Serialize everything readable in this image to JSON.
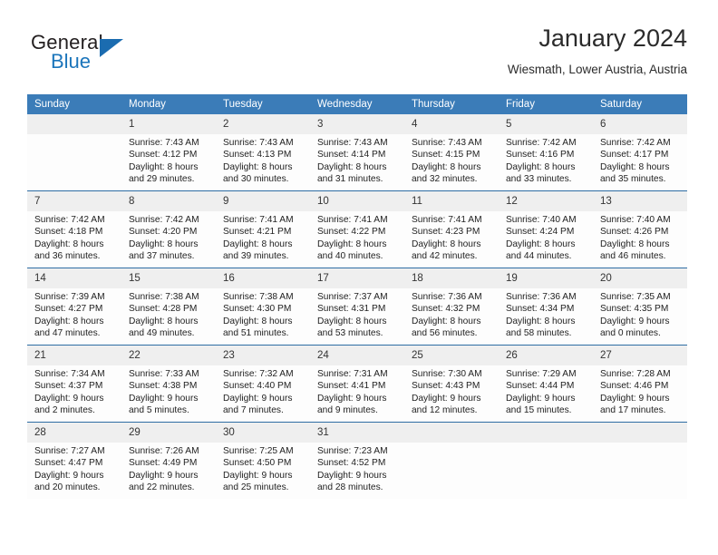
{
  "brand": {
    "name_top": "General",
    "name_bottom": "Blue",
    "accent_color": "#1b75bb",
    "triangle_color": "#1b6cb0"
  },
  "header": {
    "title": "January 2024",
    "location": "Wiesmath, Lower Austria, Austria"
  },
  "theme": {
    "header_row_bg": "#3b7cb8",
    "daynum_bg": "#efefef",
    "row_divider": "#2e6da4"
  },
  "weekday_headers": [
    "Sunday",
    "Monday",
    "Tuesday",
    "Wednesday",
    "Thursday",
    "Friday",
    "Saturday"
  ],
  "weeks": [
    [
      {
        "day": "",
        "empty": true,
        "sunrise": "",
        "sunset": "",
        "daylight_1": "",
        "daylight_2": ""
      },
      {
        "day": "1",
        "sunrise": "Sunrise: 7:43 AM",
        "sunset": "Sunset: 4:12 PM",
        "daylight_1": "Daylight: 8 hours",
        "daylight_2": "and 29 minutes."
      },
      {
        "day": "2",
        "sunrise": "Sunrise: 7:43 AM",
        "sunset": "Sunset: 4:13 PM",
        "daylight_1": "Daylight: 8 hours",
        "daylight_2": "and 30 minutes."
      },
      {
        "day": "3",
        "sunrise": "Sunrise: 7:43 AM",
        "sunset": "Sunset: 4:14 PM",
        "daylight_1": "Daylight: 8 hours",
        "daylight_2": "and 31 minutes."
      },
      {
        "day": "4",
        "sunrise": "Sunrise: 7:43 AM",
        "sunset": "Sunset: 4:15 PM",
        "daylight_1": "Daylight: 8 hours",
        "daylight_2": "and 32 minutes."
      },
      {
        "day": "5",
        "sunrise": "Sunrise: 7:42 AM",
        "sunset": "Sunset: 4:16 PM",
        "daylight_1": "Daylight: 8 hours",
        "daylight_2": "and 33 minutes."
      },
      {
        "day": "6",
        "sunrise": "Sunrise: 7:42 AM",
        "sunset": "Sunset: 4:17 PM",
        "daylight_1": "Daylight: 8 hours",
        "daylight_2": "and 35 minutes."
      }
    ],
    [
      {
        "day": "7",
        "sunrise": "Sunrise: 7:42 AM",
        "sunset": "Sunset: 4:18 PM",
        "daylight_1": "Daylight: 8 hours",
        "daylight_2": "and 36 minutes."
      },
      {
        "day": "8",
        "sunrise": "Sunrise: 7:42 AM",
        "sunset": "Sunset: 4:20 PM",
        "daylight_1": "Daylight: 8 hours",
        "daylight_2": "and 37 minutes."
      },
      {
        "day": "9",
        "sunrise": "Sunrise: 7:41 AM",
        "sunset": "Sunset: 4:21 PM",
        "daylight_1": "Daylight: 8 hours",
        "daylight_2": "and 39 minutes."
      },
      {
        "day": "10",
        "sunrise": "Sunrise: 7:41 AM",
        "sunset": "Sunset: 4:22 PM",
        "daylight_1": "Daylight: 8 hours",
        "daylight_2": "and 40 minutes."
      },
      {
        "day": "11",
        "sunrise": "Sunrise: 7:41 AM",
        "sunset": "Sunset: 4:23 PM",
        "daylight_1": "Daylight: 8 hours",
        "daylight_2": "and 42 minutes."
      },
      {
        "day": "12",
        "sunrise": "Sunrise: 7:40 AM",
        "sunset": "Sunset: 4:24 PM",
        "daylight_1": "Daylight: 8 hours",
        "daylight_2": "and 44 minutes."
      },
      {
        "day": "13",
        "sunrise": "Sunrise: 7:40 AM",
        "sunset": "Sunset: 4:26 PM",
        "daylight_1": "Daylight: 8 hours",
        "daylight_2": "and 46 minutes."
      }
    ],
    [
      {
        "day": "14",
        "sunrise": "Sunrise: 7:39 AM",
        "sunset": "Sunset: 4:27 PM",
        "daylight_1": "Daylight: 8 hours",
        "daylight_2": "and 47 minutes."
      },
      {
        "day": "15",
        "sunrise": "Sunrise: 7:38 AM",
        "sunset": "Sunset: 4:28 PM",
        "daylight_1": "Daylight: 8 hours",
        "daylight_2": "and 49 minutes."
      },
      {
        "day": "16",
        "sunrise": "Sunrise: 7:38 AM",
        "sunset": "Sunset: 4:30 PM",
        "daylight_1": "Daylight: 8 hours",
        "daylight_2": "and 51 minutes."
      },
      {
        "day": "17",
        "sunrise": "Sunrise: 7:37 AM",
        "sunset": "Sunset: 4:31 PM",
        "daylight_1": "Daylight: 8 hours",
        "daylight_2": "and 53 minutes."
      },
      {
        "day": "18",
        "sunrise": "Sunrise: 7:36 AM",
        "sunset": "Sunset: 4:32 PM",
        "daylight_1": "Daylight: 8 hours",
        "daylight_2": "and 56 minutes."
      },
      {
        "day": "19",
        "sunrise": "Sunrise: 7:36 AM",
        "sunset": "Sunset: 4:34 PM",
        "daylight_1": "Daylight: 8 hours",
        "daylight_2": "and 58 minutes."
      },
      {
        "day": "20",
        "sunrise": "Sunrise: 7:35 AM",
        "sunset": "Sunset: 4:35 PM",
        "daylight_1": "Daylight: 9 hours",
        "daylight_2": "and 0 minutes."
      }
    ],
    [
      {
        "day": "21",
        "sunrise": "Sunrise: 7:34 AM",
        "sunset": "Sunset: 4:37 PM",
        "daylight_1": "Daylight: 9 hours",
        "daylight_2": "and 2 minutes."
      },
      {
        "day": "22",
        "sunrise": "Sunrise: 7:33 AM",
        "sunset": "Sunset: 4:38 PM",
        "daylight_1": "Daylight: 9 hours",
        "daylight_2": "and 5 minutes."
      },
      {
        "day": "23",
        "sunrise": "Sunrise: 7:32 AM",
        "sunset": "Sunset: 4:40 PM",
        "daylight_1": "Daylight: 9 hours",
        "daylight_2": "and 7 minutes."
      },
      {
        "day": "24",
        "sunrise": "Sunrise: 7:31 AM",
        "sunset": "Sunset: 4:41 PM",
        "daylight_1": "Daylight: 9 hours",
        "daylight_2": "and 9 minutes."
      },
      {
        "day": "25",
        "sunrise": "Sunrise: 7:30 AM",
        "sunset": "Sunset: 4:43 PM",
        "daylight_1": "Daylight: 9 hours",
        "daylight_2": "and 12 minutes."
      },
      {
        "day": "26",
        "sunrise": "Sunrise: 7:29 AM",
        "sunset": "Sunset: 4:44 PM",
        "daylight_1": "Daylight: 9 hours",
        "daylight_2": "and 15 minutes."
      },
      {
        "day": "27",
        "sunrise": "Sunrise: 7:28 AM",
        "sunset": "Sunset: 4:46 PM",
        "daylight_1": "Daylight: 9 hours",
        "daylight_2": "and 17 minutes."
      }
    ],
    [
      {
        "day": "28",
        "sunrise": "Sunrise: 7:27 AM",
        "sunset": "Sunset: 4:47 PM",
        "daylight_1": "Daylight: 9 hours",
        "daylight_2": "and 20 minutes."
      },
      {
        "day": "29",
        "sunrise": "Sunrise: 7:26 AM",
        "sunset": "Sunset: 4:49 PM",
        "daylight_1": "Daylight: 9 hours",
        "daylight_2": "and 22 minutes."
      },
      {
        "day": "30",
        "sunrise": "Sunrise: 7:25 AM",
        "sunset": "Sunset: 4:50 PM",
        "daylight_1": "Daylight: 9 hours",
        "daylight_2": "and 25 minutes."
      },
      {
        "day": "31",
        "sunrise": "Sunrise: 7:23 AM",
        "sunset": "Sunset: 4:52 PM",
        "daylight_1": "Daylight: 9 hours",
        "daylight_2": "and 28 minutes."
      },
      {
        "day": "",
        "empty": true,
        "sunrise": "",
        "sunset": "",
        "daylight_1": "",
        "daylight_2": ""
      },
      {
        "day": "",
        "empty": true,
        "sunrise": "",
        "sunset": "",
        "daylight_1": "",
        "daylight_2": ""
      },
      {
        "day": "",
        "empty": true,
        "sunrise": "",
        "sunset": "",
        "daylight_1": "",
        "daylight_2": ""
      }
    ]
  ]
}
